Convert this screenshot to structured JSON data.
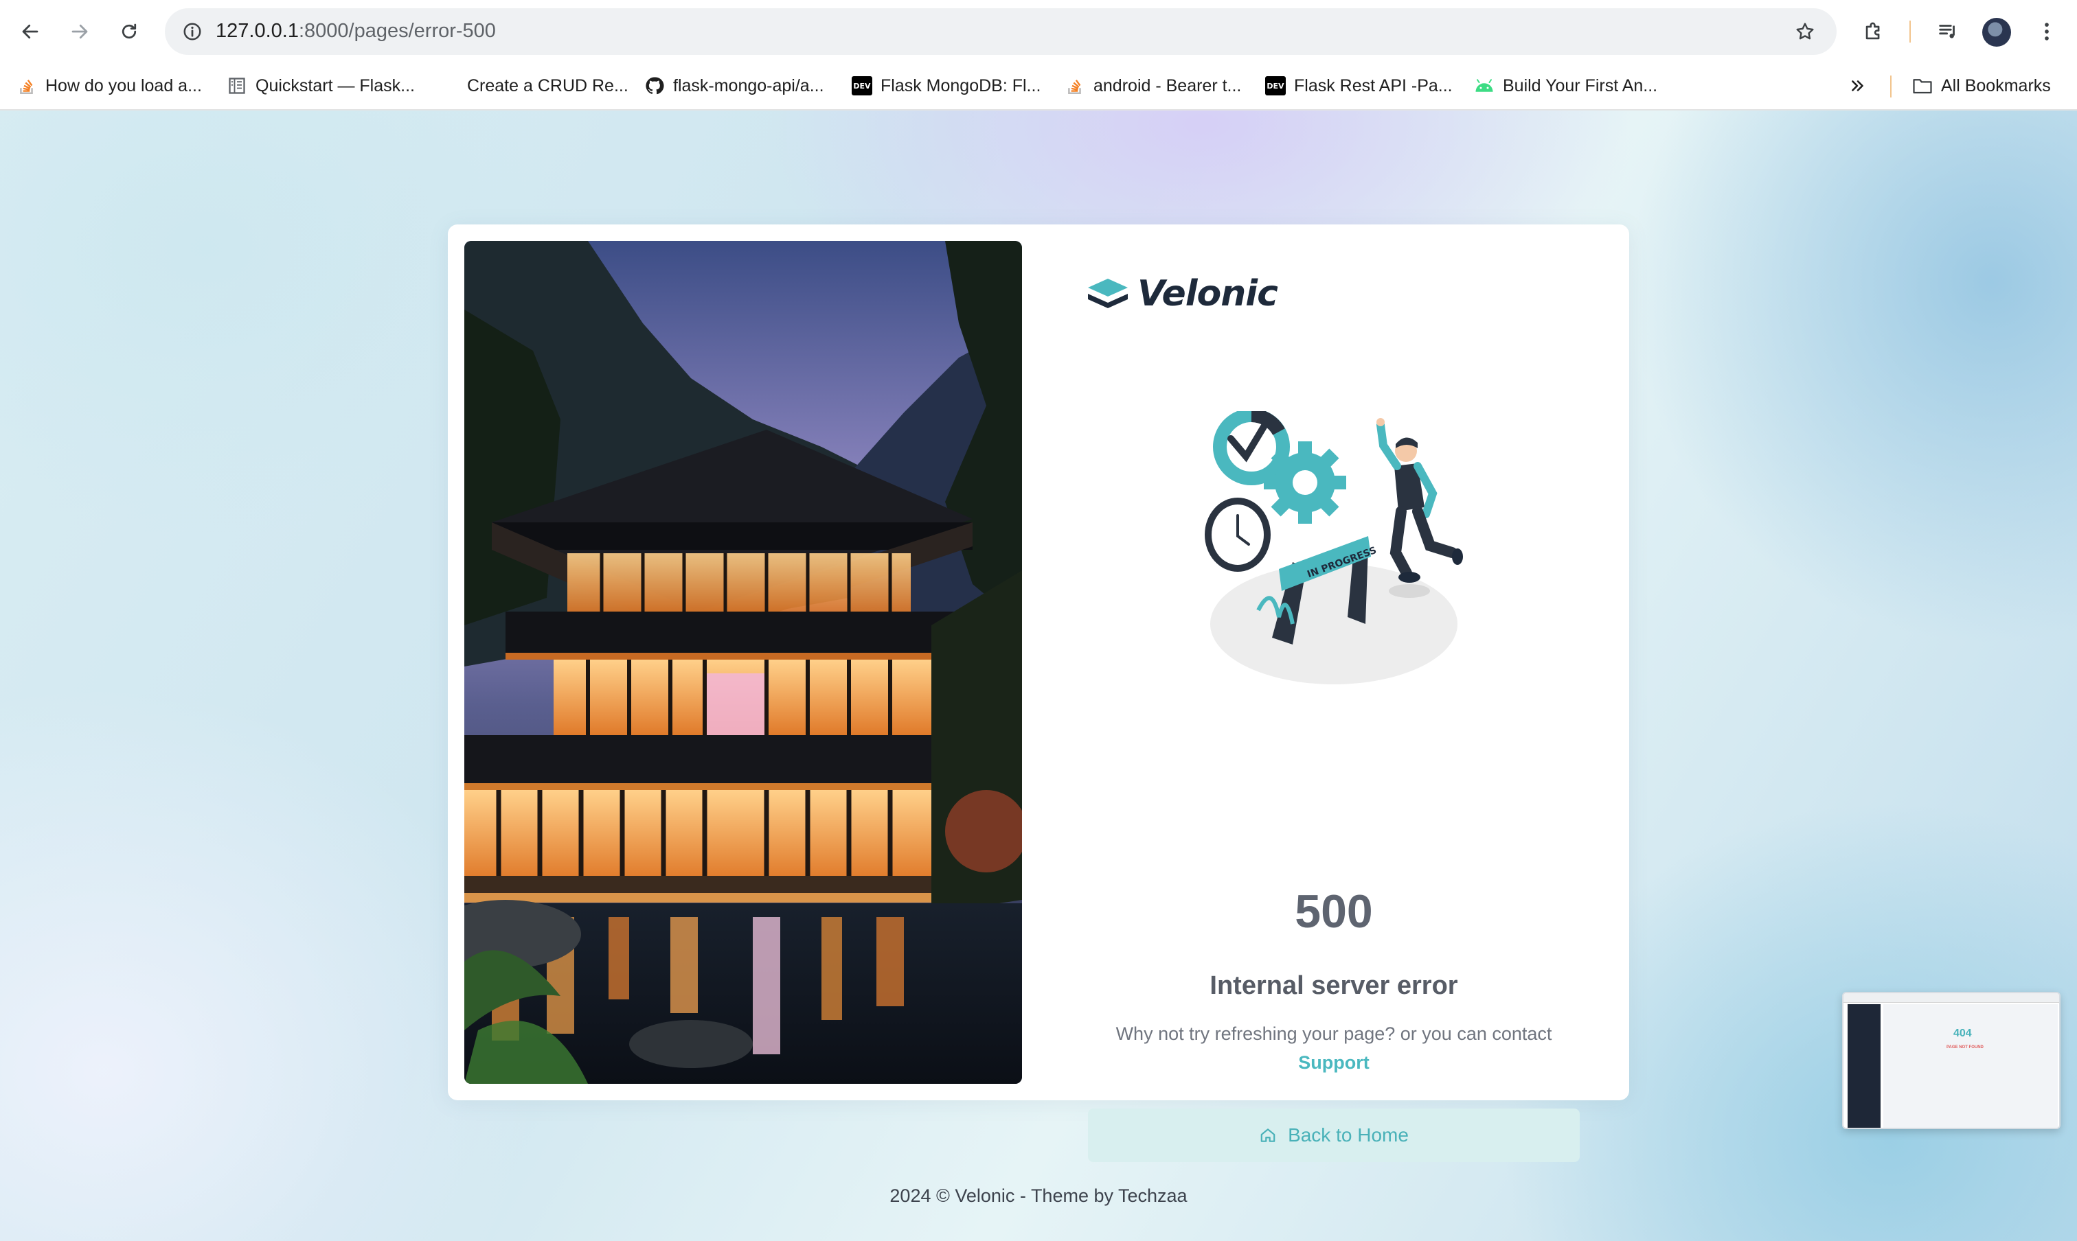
{
  "browser": {
    "url_host": "127.0.0.1",
    "url_path": ":8000/pages/error-500",
    "bookmarks": [
      {
        "label": "How do you load a...",
        "icon": "stackoverflow-icon"
      },
      {
        "label": "Quickstart — Flask...",
        "icon": "docs-icon"
      },
      {
        "label": "Create a CRUD Re...",
        "icon": "blank-icon"
      },
      {
        "label": "flask-mongo-api/a...",
        "icon": "github-icon"
      },
      {
        "label": "Flask MongoDB: Fl...",
        "icon": "dev-icon"
      },
      {
        "label": "android - Bearer t...",
        "icon": "stackoverflow-icon"
      },
      {
        "label": "Flask Rest API -Pa...",
        "icon": "dev-icon"
      },
      {
        "label": "Build Your First An...",
        "icon": "android-icon"
      }
    ],
    "all_bookmarks_label": "All Bookmarks",
    "dev_badge": "DEV"
  },
  "page": {
    "brand": "Velonic",
    "error_code": "500",
    "title": "Internal server error",
    "message": "Why not try refreshing your page? or you can contact",
    "support_link": "Support",
    "back_button": "Back to Home",
    "illustration_banner": "IN PROGRESS",
    "footer": "2024 © Velonic - Theme by Techzaa"
  },
  "thumbnail": {
    "code": "404",
    "subtitle": "PAGE NOT FOUND"
  },
  "colors": {
    "accent": "#4ab8bf",
    "button_bg": "#d8efef",
    "brand_text": "#1e2a3b"
  }
}
